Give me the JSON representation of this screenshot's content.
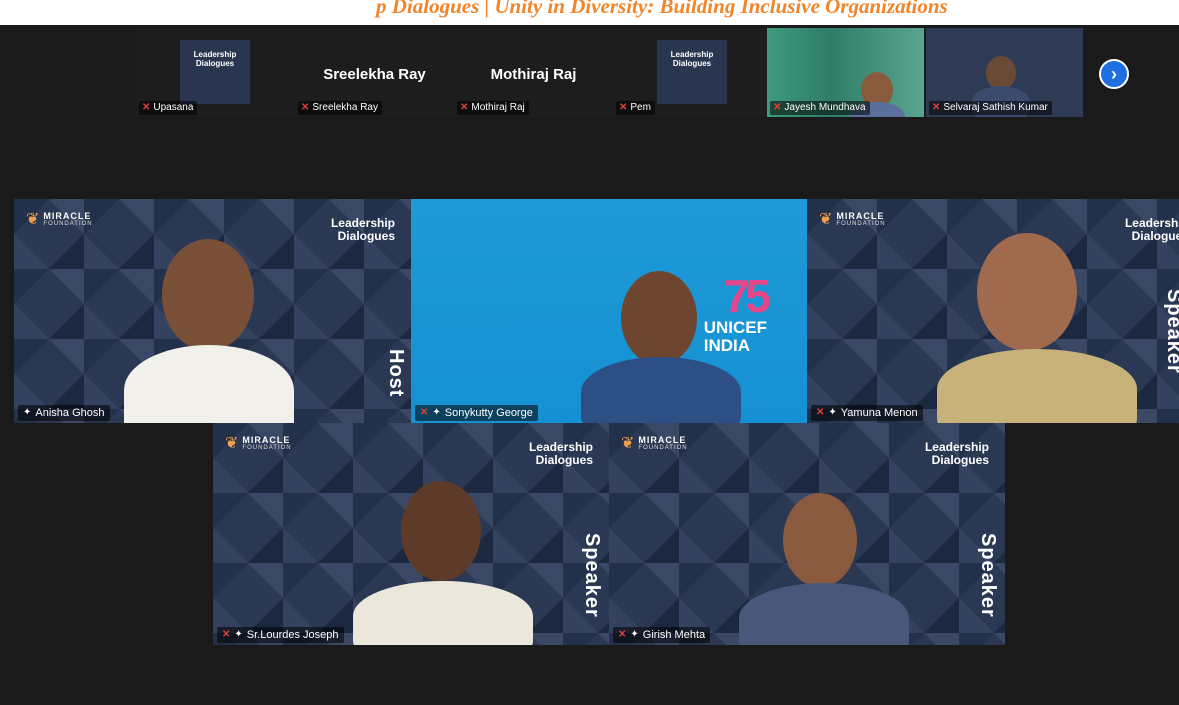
{
  "banner": {
    "text": "p Dialogues | Unity in Diversity: Building Inclusive Organizations"
  },
  "strip": {
    "thumbs": [
      {
        "name": "Upasana",
        "display": "",
        "logo": "Leadership Dialogues"
      },
      {
        "name": "Sreelekha Ray",
        "display": "Sreelekha Ray",
        "logo": ""
      },
      {
        "name": "Mothiraj Raj",
        "display": "Mothiraj Raj",
        "logo": ""
      },
      {
        "name": "Pem",
        "display": "",
        "logo": "Leadership Dialogues"
      },
      {
        "name": "Jayesh Mundhava",
        "display": "",
        "logo": ""
      },
      {
        "name": "Selvaraj Sathish Kumar",
        "display": "",
        "logo": ""
      }
    ],
    "next_icon": "chevron-right-icon",
    "next_glyph": "›"
  },
  "tiles": {
    "anisha": {
      "name": "Anisha Ghosh",
      "side": "Host",
      "brand": "MIRACLE",
      "brand_sub": "FOUNDATION",
      "title1": "Leadership",
      "title2": "Dialogues"
    },
    "sonykutty": {
      "name": "Sonykutty George",
      "logo_num": "75",
      "logo_text1": "UNICEF",
      "logo_text2": "INDIA"
    },
    "yamuna": {
      "name": "Yamuna Menon",
      "side": "Speaker",
      "brand": "MIRACLE",
      "brand_sub": "FOUNDATION",
      "title1": "Leadership",
      "title2": "Dialogues"
    },
    "lourdes": {
      "name": "Sr.Lourdes Joseph",
      "side": "Speaker",
      "brand": "MIRACLE",
      "brand_sub": "FOUNDATION",
      "title1": "Leadership",
      "title2": "Dialogues"
    },
    "girish": {
      "name": "Girish Mehta",
      "side": "Speaker",
      "brand": "MIRACLE",
      "brand_sub": "FOUNDATION",
      "title1": "Leadership",
      "title2": "Dialogues"
    }
  },
  "colors": {
    "active_border": "#3ed67d",
    "muted_mic": "#e0413a",
    "accent": "#f2842a"
  }
}
